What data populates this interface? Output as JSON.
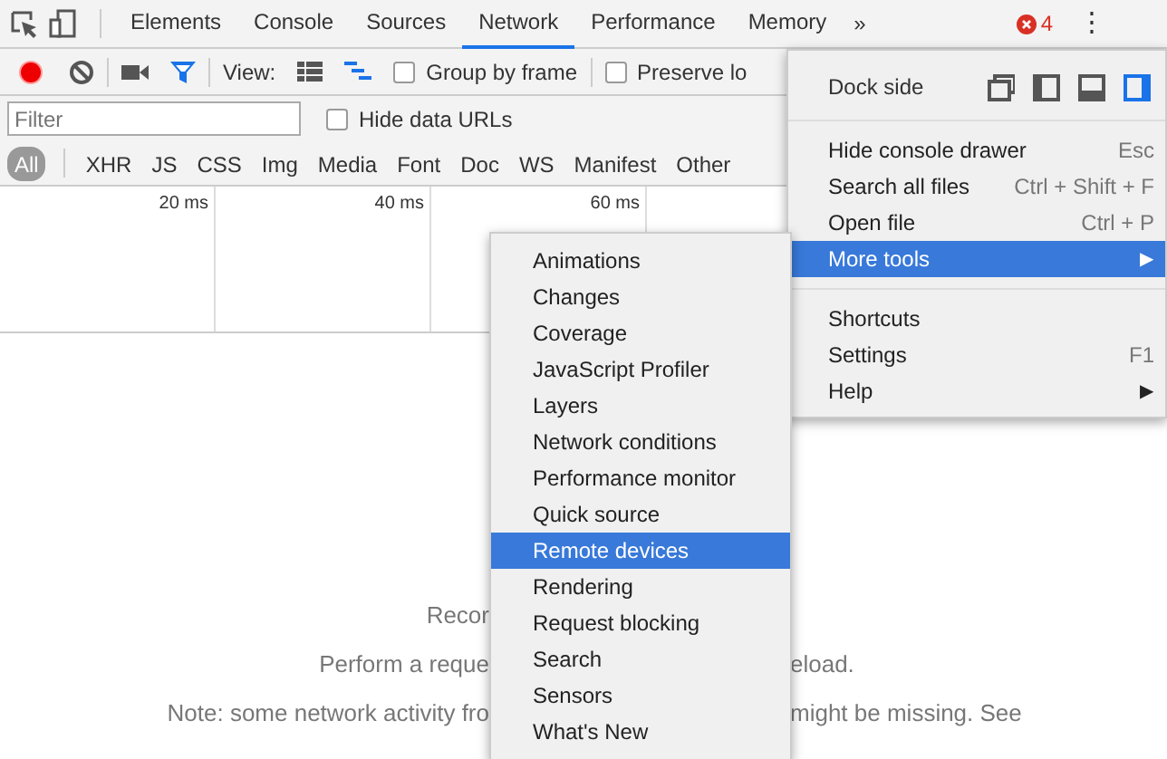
{
  "tabs": [
    {
      "label": "Elements",
      "selected": false
    },
    {
      "label": "Console",
      "selected": false
    },
    {
      "label": "Sources",
      "selected": false
    },
    {
      "label": "Network",
      "selected": true
    },
    {
      "label": "Performance",
      "selected": false
    },
    {
      "label": "Memory",
      "selected": false
    }
  ],
  "tabs_overflow": "»",
  "error_count": "4",
  "more_button": "⋮",
  "toolbar": {
    "view_label": "View:",
    "checkboxes": [
      {
        "label": "Group by frame",
        "checked": false
      },
      {
        "label": "Preserve lo",
        "checked": false
      }
    ]
  },
  "filter": {
    "placeholder": "Filter",
    "hide_data_urls": {
      "label": "Hide data URLs",
      "checked": false
    }
  },
  "type_filters": [
    {
      "label": "All",
      "selected": true
    },
    {
      "label": "XHR",
      "selected": false
    },
    {
      "label": "JS",
      "selected": false
    },
    {
      "label": "CSS",
      "selected": false
    },
    {
      "label": "Img",
      "selected": false
    },
    {
      "label": "Media",
      "selected": false
    },
    {
      "label": "Font",
      "selected": false
    },
    {
      "label": "Doc",
      "selected": false
    },
    {
      "label": "WS",
      "selected": false
    },
    {
      "label": "Manifest",
      "selected": false
    },
    {
      "label": "Other",
      "selected": false
    }
  ],
  "timeline": {
    "ticks": [
      "20 ms",
      "40 ms",
      "60 ms"
    ]
  },
  "empty_state": [
    {
      "left": "Recor"
    },
    {
      "left": "Perform a reque",
      "right": "eload."
    },
    {
      "left": "Note: some network activity fro",
      "right": "might be missing. See"
    }
  ],
  "main_menu": {
    "dock_label": "Dock side",
    "dock_options": [
      {
        "kind": "undock",
        "selected": false
      },
      {
        "kind": "left",
        "selected": false
      },
      {
        "kind": "bottom",
        "selected": false
      },
      {
        "kind": "right",
        "selected": true
      }
    ],
    "sections": [
      [
        {
          "label": "Hide console drawer",
          "shortcut": "Esc",
          "selected": false
        },
        {
          "label": "Search all files",
          "shortcut": "Ctrl + Shift + F",
          "selected": false
        },
        {
          "label": "Open file",
          "shortcut": "Ctrl + P",
          "selected": false
        },
        {
          "label": "More tools",
          "arrow": "▶",
          "selected": true
        }
      ],
      [
        {
          "label": "Shortcuts",
          "selected": false
        },
        {
          "label": "Settings",
          "shortcut": "F1",
          "selected": false
        },
        {
          "label": "Help",
          "arrow": "▶",
          "selected": false
        }
      ]
    ]
  },
  "more_tools_menu": [
    {
      "label": "Animations",
      "selected": false
    },
    {
      "label": "Changes",
      "selected": false
    },
    {
      "label": "Coverage",
      "selected": false
    },
    {
      "label": "JavaScript Profiler",
      "selected": false
    },
    {
      "label": "Layers",
      "selected": false
    },
    {
      "label": "Network conditions",
      "selected": false
    },
    {
      "label": "Performance monitor",
      "selected": false
    },
    {
      "label": "Quick source",
      "selected": false
    },
    {
      "label": "Remote devices",
      "selected": true
    },
    {
      "label": "Rendering",
      "selected": false
    },
    {
      "label": "Request blocking",
      "selected": false
    },
    {
      "label": "Search",
      "selected": false
    },
    {
      "label": "Sensors",
      "selected": false
    },
    {
      "label": "What's New",
      "selected": false
    }
  ]
}
